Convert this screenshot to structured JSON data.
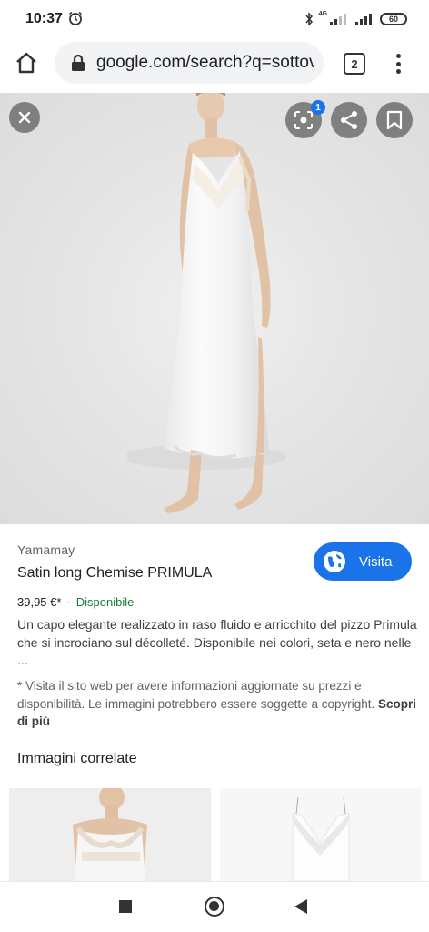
{
  "status_bar": {
    "time": "10:37",
    "network_label": "4G",
    "battery_level": "60"
  },
  "browser": {
    "url": "google.com/search?q=sottoveste",
    "tab_count": "2"
  },
  "viewer": {
    "lens_badge_count": "1"
  },
  "result": {
    "source": "Yamamay",
    "title": "Satin long Chemise PRIMULA",
    "price": "39,95 €*",
    "separator": "·",
    "availability": "Disponibile",
    "description": "Un capo elegante realizzato in raso fluido e arricchito del pizzo Primula che si incrociano sul décolleté. Disponibile nei colori, seta e nero nelle ...",
    "notice": "* Visita il sito web per avere informazioni aggiornate su prezzi e disponibilità. Le immagini potrebbero essere soggette a copyright.",
    "learn_more": "Scopri di più",
    "visit_label": "Visita"
  },
  "related": {
    "title": "Immagini correlate"
  },
  "colors": {
    "accent": "#1a73e8",
    "available_green": "#188038"
  },
  "icons": [
    "alarm-icon",
    "bluetooth-icon",
    "signal-icon",
    "battery-icon",
    "home-icon",
    "lock-icon",
    "tabs-icon",
    "more-vert-icon",
    "close-icon",
    "lens-icon",
    "share-icon",
    "bookmark-icon",
    "globe-icon"
  ]
}
